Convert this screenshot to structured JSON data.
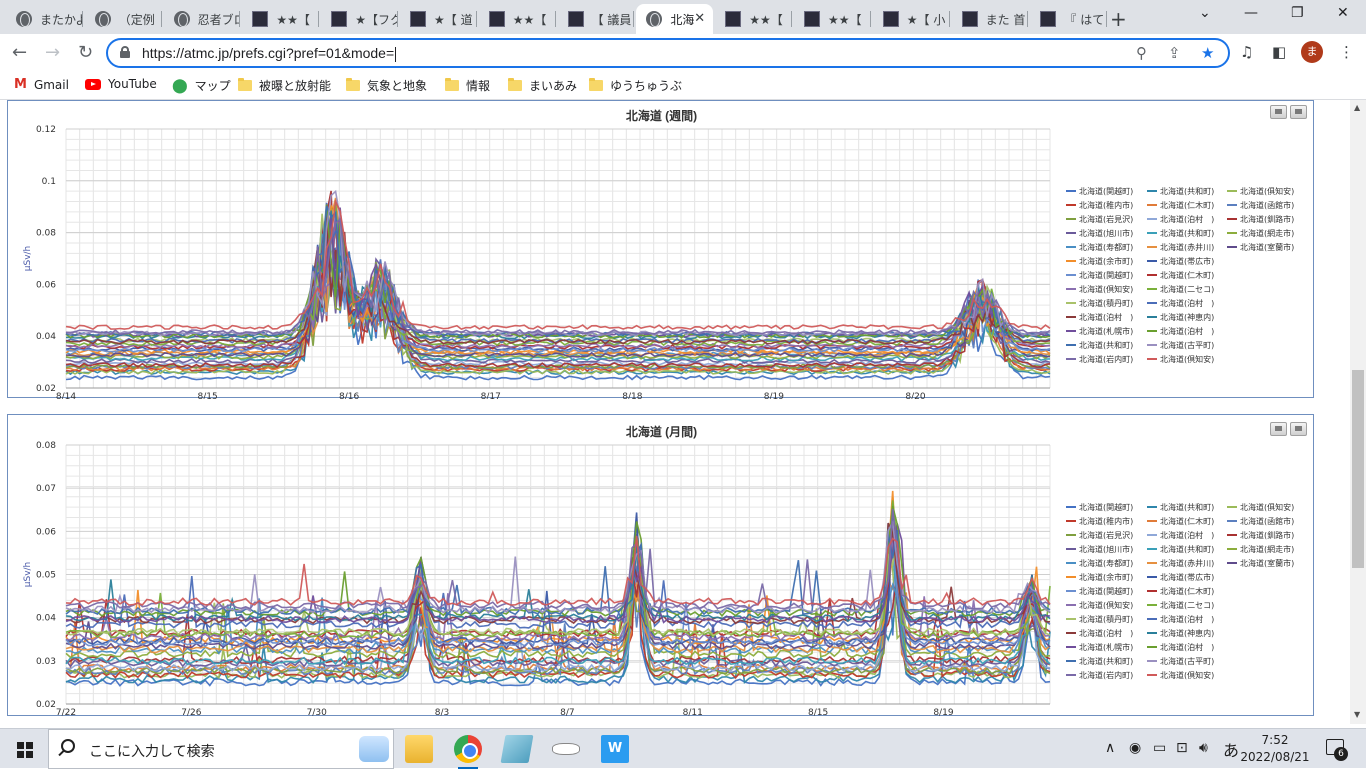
{
  "tabs": [
    {
      "label": "またかよ"
    },
    {
      "label": "（定例"
    },
    {
      "label": "忍者ブロ"
    },
    {
      "label": "★★【"
    },
    {
      "label": "★【フク"
    },
    {
      "label": "★【 道"
    },
    {
      "label": "★★【"
    },
    {
      "label": "【 議員"
    },
    {
      "label": "北海",
      "active": true
    },
    {
      "label": "★★【"
    },
    {
      "label": "★★【"
    },
    {
      "label": "★【 小"
    },
    {
      "label": "また 首"
    },
    {
      "label": "『 はて"
    }
  ],
  "toolbar": {
    "url": "https://atmc.jp/prefs.cgi?pref=01&mode=",
    "profile_initial": "ま"
  },
  "bookmarks": [
    {
      "label": "Gmail",
      "icon": "gmail-icon"
    },
    {
      "label": "YouTube",
      "icon": "youtube-icon"
    },
    {
      "label": "マップ",
      "icon": "maps-icon"
    },
    {
      "label": "被曝と放射能",
      "icon": "folder-icon"
    },
    {
      "label": "気象と地象",
      "icon": "folder-icon"
    },
    {
      "label": "情報",
      "icon": "folder-icon"
    },
    {
      "label": "まいあみ",
      "icon": "folder-icon"
    },
    {
      "label": "ゆうちゅうぶ",
      "icon": "folder-icon"
    }
  ],
  "legend_entries": [
    "北海道(関越町)",
    "北海道(共和町)",
    "北海道(俱知安)",
    "北海道(稚内市)",
    "北海道(仁木町)",
    "北海道(函館市)",
    "北海道(岩見沢)",
    "北海道(泊村　)",
    "北海道(釧路市)",
    "北海道(旭川市)",
    "北海道(共和町)",
    "北海道(網走市)",
    "北海道(寿都町)",
    "北海道(赤井川)",
    "北海道(室蘭市)",
    "北海道(余市町)",
    "北海道(帯広市)",
    "北海道(関越町)",
    "北海道(仁木町)",
    "北海道(倶知安)",
    "北海道(二セコ)",
    "北海道(積丹町)",
    "北海道(泊村　)",
    "北海道(泊村　)",
    "北海道(神恵内)",
    "北海道(札幌市)",
    "北海道(泊村　)",
    "北海道(共和町)",
    "北海道(古平町)",
    "北海道(岩内町)",
    "北海道(倶知安)"
  ],
  "chart_data": [
    {
      "type": "line",
      "title": "北海道 (週間)",
      "ylabel": "μSv/h",
      "ylim": [
        0.02,
        0.12
      ],
      "yticks": [
        "0.12",
        "0.1",
        "0.08",
        "0.06",
        "0.04",
        "0.02"
      ],
      "xticks": [
        "8/14",
        "8/15",
        "8/16",
        "8/17",
        "8/18",
        "8/19",
        "8/20"
      ],
      "grid": true,
      "legend": "right",
      "series_count": 31,
      "baseline_range": [
        0.025,
        0.043
      ],
      "peaks": [
        {
          "x": "8/15 after noon",
          "y": 0.098
        },
        {
          "x": "8/16 morning",
          "y": 0.07
        },
        {
          "x": "8/20 afternoon",
          "y": 0.063
        }
      ]
    },
    {
      "type": "line",
      "title": "北海道 (月間)",
      "ylabel": "μSv/h",
      "ylim": [
        0.02,
        0.08
      ],
      "yticks": [
        "0.08",
        "0.07",
        "0.06",
        "0.05",
        "0.04",
        "0.03",
        "0.02"
      ],
      "xticks": [
        "7/22",
        "7/26",
        "7/30",
        "8/3",
        "8/7",
        "8/11",
        "8/15",
        "8/19"
      ],
      "grid": true,
      "legend": "right",
      "series_count": 31,
      "baseline_range": [
        0.025,
        0.043
      ],
      "peaks": [
        {
          "x": "8/2",
          "y": 0.055
        },
        {
          "x": "8/9",
          "y": 0.064
        },
        {
          "x": "8/15",
          "y": 0.071
        },
        {
          "x": "8/20",
          "y": 0.051
        }
      ]
    }
  ],
  "series_colors": [
    "#4472c4",
    "#2e86ab",
    "#9bbb59",
    "#c0392b",
    "#e07b39",
    "#5b7fbf",
    "#7f9f3f",
    "#8fa8d8",
    "#a83232",
    "#6a5a9a",
    "#3aa0b8",
    "#8cad3c",
    "#4a8fc4",
    "#e69040",
    "#5e4b8b",
    "#f28e2b",
    "#3a5aa8",
    "#6b8fd0",
    "#b03030",
    "#8a6fb0",
    "#7ab03a",
    "#a9c26a",
    "#4b6db8",
    "#8b3a3a",
    "#2a7f9a",
    "#704e9c",
    "#6a9f2f",
    "#3f6fb0",
    "#9a90c0",
    "#7a6aa8",
    "#d05a5a"
  ],
  "taskbar": {
    "search_placeholder": "ここに入力して検索",
    "time": "7:52",
    "date": "2022/08/21",
    "ime": "あ",
    "notification_count": "6"
  }
}
